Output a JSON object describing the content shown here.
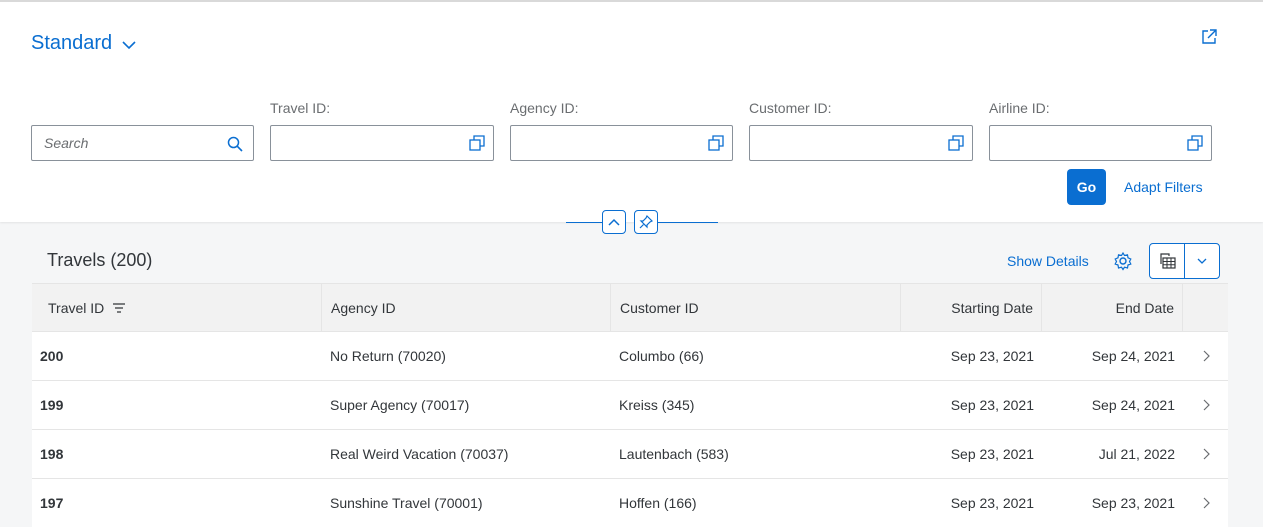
{
  "header": {
    "variant_title": "Standard",
    "filters": {
      "search_placeholder": "Search",
      "travel_id_label": "Travel ID:",
      "agency_id_label": "Agency ID:",
      "customer_id_label": "Customer ID:",
      "airline_id_label": "Airline ID:"
    },
    "go_label": "Go",
    "adapt_filters_label": "Adapt Filters"
  },
  "table": {
    "title": "Travels (200)",
    "show_details_label": "Show Details",
    "columns": {
      "travel_id": "Travel ID",
      "agency_id": "Agency ID",
      "customer_id": "Customer ID",
      "starting_date": "Starting Date",
      "end_date": "End Date"
    },
    "rows": [
      {
        "travel_id": "200",
        "agency": "No Return (70020)",
        "customer": "Columbo (66)",
        "start": "Sep 23, 2021",
        "end": "Sep 24, 2021"
      },
      {
        "travel_id": "199",
        "agency": "Super Agency (70017)",
        "customer": "Kreiss (345)",
        "start": "Sep 23, 2021",
        "end": "Sep 24, 2021"
      },
      {
        "travel_id": "198",
        "agency": "Real Weird Vacation (70037)",
        "customer": "Lautenbach (583)",
        "start": "Sep 23, 2021",
        "end": "Jul 21, 2022"
      },
      {
        "travel_id": "197",
        "agency": "Sunshine Travel (70001)",
        "customer": "Hoffen (166)",
        "start": "Sep 23, 2021",
        "end": "Sep 23, 2021"
      }
    ]
  },
  "colors": {
    "accent": "#0a6ed1",
    "text": "#32363a",
    "muted": "#6a6d70"
  }
}
